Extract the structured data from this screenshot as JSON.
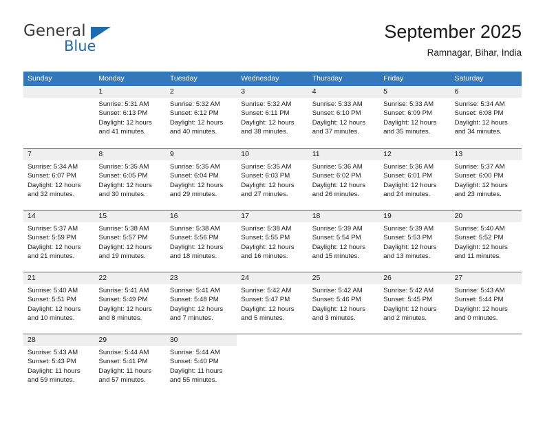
{
  "brand": {
    "name_top": "General",
    "name_bottom": "Blue",
    "triangle_icon": "triangle-icon",
    "accent_color": "#1b6cb0"
  },
  "header": {
    "title": "September 2025",
    "location": "Ramnagar, Bihar, India"
  },
  "theme": {
    "header_bg": "#3478bc",
    "header_text": "#ffffff",
    "row_divider": "#2f6fb0",
    "date_strip_bg": "#efefef",
    "text": "#1a1a1a"
  },
  "calendar": {
    "weekdays": [
      "Sunday",
      "Monday",
      "Tuesday",
      "Wednesday",
      "Thursday",
      "Friday",
      "Saturday"
    ],
    "weeks": [
      [
        {
          "day": "",
          "lines": []
        },
        {
          "day": "1",
          "lines": [
            "Sunrise: 5:31 AM",
            "Sunset: 6:13 PM",
            "Daylight: 12 hours",
            "and 41 minutes."
          ]
        },
        {
          "day": "2",
          "lines": [
            "Sunrise: 5:32 AM",
            "Sunset: 6:12 PM",
            "Daylight: 12 hours",
            "and 40 minutes."
          ]
        },
        {
          "day": "3",
          "lines": [
            "Sunrise: 5:32 AM",
            "Sunset: 6:11 PM",
            "Daylight: 12 hours",
            "and 38 minutes."
          ]
        },
        {
          "day": "4",
          "lines": [
            "Sunrise: 5:33 AM",
            "Sunset: 6:10 PM",
            "Daylight: 12 hours",
            "and 37 minutes."
          ]
        },
        {
          "day": "5",
          "lines": [
            "Sunrise: 5:33 AM",
            "Sunset: 6:09 PM",
            "Daylight: 12 hours",
            "and 35 minutes."
          ]
        },
        {
          "day": "6",
          "lines": [
            "Sunrise: 5:34 AM",
            "Sunset: 6:08 PM",
            "Daylight: 12 hours",
            "and 34 minutes."
          ]
        }
      ],
      [
        {
          "day": "7",
          "lines": [
            "Sunrise: 5:34 AM",
            "Sunset: 6:07 PM",
            "Daylight: 12 hours",
            "and 32 minutes."
          ]
        },
        {
          "day": "8",
          "lines": [
            "Sunrise: 5:35 AM",
            "Sunset: 6:05 PM",
            "Daylight: 12 hours",
            "and 30 minutes."
          ]
        },
        {
          "day": "9",
          "lines": [
            "Sunrise: 5:35 AM",
            "Sunset: 6:04 PM",
            "Daylight: 12 hours",
            "and 29 minutes."
          ]
        },
        {
          "day": "10",
          "lines": [
            "Sunrise: 5:35 AM",
            "Sunset: 6:03 PM",
            "Daylight: 12 hours",
            "and 27 minutes."
          ]
        },
        {
          "day": "11",
          "lines": [
            "Sunrise: 5:36 AM",
            "Sunset: 6:02 PM",
            "Daylight: 12 hours",
            "and 26 minutes."
          ]
        },
        {
          "day": "12",
          "lines": [
            "Sunrise: 5:36 AM",
            "Sunset: 6:01 PM",
            "Daylight: 12 hours",
            "and 24 minutes."
          ]
        },
        {
          "day": "13",
          "lines": [
            "Sunrise: 5:37 AM",
            "Sunset: 6:00 PM",
            "Daylight: 12 hours",
            "and 23 minutes."
          ]
        }
      ],
      [
        {
          "day": "14",
          "lines": [
            "Sunrise: 5:37 AM",
            "Sunset: 5:59 PM",
            "Daylight: 12 hours",
            "and 21 minutes."
          ]
        },
        {
          "day": "15",
          "lines": [
            "Sunrise: 5:38 AM",
            "Sunset: 5:57 PM",
            "Daylight: 12 hours",
            "and 19 minutes."
          ]
        },
        {
          "day": "16",
          "lines": [
            "Sunrise: 5:38 AM",
            "Sunset: 5:56 PM",
            "Daylight: 12 hours",
            "and 18 minutes."
          ]
        },
        {
          "day": "17",
          "lines": [
            "Sunrise: 5:38 AM",
            "Sunset: 5:55 PM",
            "Daylight: 12 hours",
            "and 16 minutes."
          ]
        },
        {
          "day": "18",
          "lines": [
            "Sunrise: 5:39 AM",
            "Sunset: 5:54 PM",
            "Daylight: 12 hours",
            "and 15 minutes."
          ]
        },
        {
          "day": "19",
          "lines": [
            "Sunrise: 5:39 AM",
            "Sunset: 5:53 PM",
            "Daylight: 12 hours",
            "and 13 minutes."
          ]
        },
        {
          "day": "20",
          "lines": [
            "Sunrise: 5:40 AM",
            "Sunset: 5:52 PM",
            "Daylight: 12 hours",
            "and 11 minutes."
          ]
        }
      ],
      [
        {
          "day": "21",
          "lines": [
            "Sunrise: 5:40 AM",
            "Sunset: 5:51 PM",
            "Daylight: 12 hours",
            "and 10 minutes."
          ]
        },
        {
          "day": "22",
          "lines": [
            "Sunrise: 5:41 AM",
            "Sunset: 5:49 PM",
            "Daylight: 12 hours",
            "and 8 minutes."
          ]
        },
        {
          "day": "23",
          "lines": [
            "Sunrise: 5:41 AM",
            "Sunset: 5:48 PM",
            "Daylight: 12 hours",
            "and 7 minutes."
          ]
        },
        {
          "day": "24",
          "lines": [
            "Sunrise: 5:42 AM",
            "Sunset: 5:47 PM",
            "Daylight: 12 hours",
            "and 5 minutes."
          ]
        },
        {
          "day": "25",
          "lines": [
            "Sunrise: 5:42 AM",
            "Sunset: 5:46 PM",
            "Daylight: 12 hours",
            "and 3 minutes."
          ]
        },
        {
          "day": "26",
          "lines": [
            "Sunrise: 5:42 AM",
            "Sunset: 5:45 PM",
            "Daylight: 12 hours",
            "and 2 minutes."
          ]
        },
        {
          "day": "27",
          "lines": [
            "Sunrise: 5:43 AM",
            "Sunset: 5:44 PM",
            "Daylight: 12 hours",
            "and 0 minutes."
          ]
        }
      ],
      [
        {
          "day": "28",
          "lines": [
            "Sunrise: 5:43 AM",
            "Sunset: 5:43 PM",
            "Daylight: 11 hours",
            "and 59 minutes."
          ]
        },
        {
          "day": "29",
          "lines": [
            "Sunrise: 5:44 AM",
            "Sunset: 5:41 PM",
            "Daylight: 11 hours",
            "and 57 minutes."
          ]
        },
        {
          "day": "30",
          "lines": [
            "Sunrise: 5:44 AM",
            "Sunset: 5:40 PM",
            "Daylight: 11 hours",
            "and 55 minutes."
          ]
        },
        {
          "day": "",
          "lines": []
        },
        {
          "day": "",
          "lines": []
        },
        {
          "day": "",
          "lines": []
        },
        {
          "day": "",
          "lines": []
        }
      ]
    ]
  }
}
